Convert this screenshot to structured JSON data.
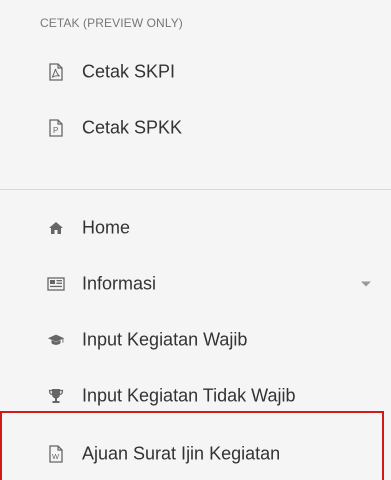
{
  "sidebar": {
    "section_print": {
      "header": "CETAK (PREVIEW ONLY)",
      "items": [
        {
          "label": "Cetak SKPI",
          "icon": "pdf-file-icon"
        },
        {
          "label": "Cetak SPKK",
          "icon": "p-file-icon"
        }
      ]
    },
    "menu": [
      {
        "label": "Home",
        "icon": "home-icon"
      },
      {
        "label": "Informasi",
        "icon": "newspaper-icon",
        "has_submenu": true
      },
      {
        "label": "Input Kegiatan Wajib",
        "icon": "graduation-cap-icon"
      },
      {
        "label": "Input Kegiatan Tidak Wajib",
        "icon": "trophy-icon"
      },
      {
        "label": "Ajuan Surat Ijin Kegiatan",
        "icon": "word-file-icon"
      }
    ]
  },
  "colors": {
    "sidebar_bg": "#f5f5f5",
    "text": "#333333",
    "header_text": "#777777",
    "icon": "#666666",
    "highlight_border": "#d11a1a"
  }
}
